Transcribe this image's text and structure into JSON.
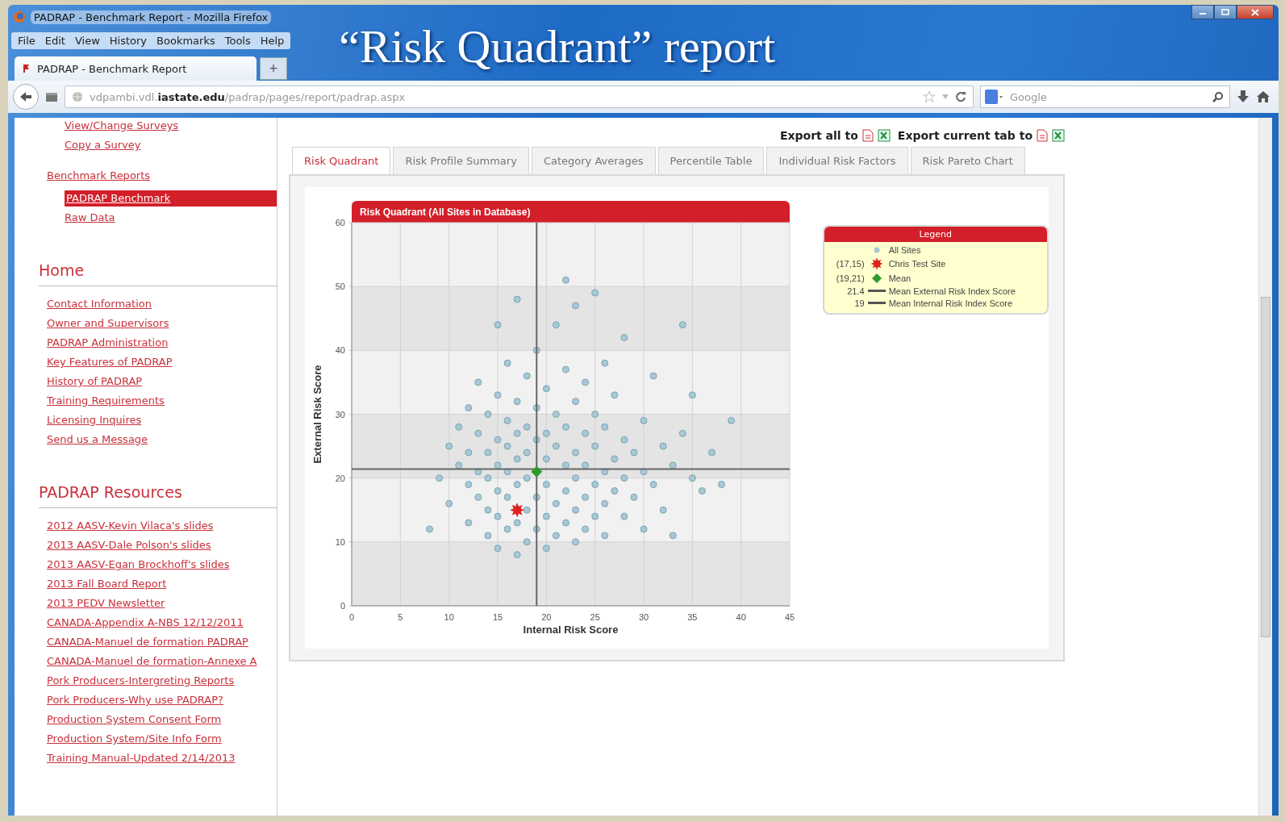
{
  "slide_title": "“Risk Quadrant” report",
  "window": {
    "title": "PADRAP - Benchmark Report - Mozilla Firefox"
  },
  "menu": [
    "File",
    "Edit",
    "View",
    "History",
    "Bookmarks",
    "Tools",
    "Help"
  ],
  "browser_tabs": [
    {
      "label": "PADRAP - Benchmark Report",
      "selected": true
    }
  ],
  "new_tab": "+",
  "address_bar": {
    "value": "vdpambi.vdl.**iastate.edu**/padrap/pages/report/padrap.aspx"
  },
  "search": {
    "placeholder": "Google"
  },
  "sidebar": {
    "sections": [
      {
        "links": [
          {
            "children": [
              {
                "label": "View/Change Surveys",
                "selected": false
              },
              {
                "label": "Copy a Survey",
                "selected": false
              }
            ]
          },
          {
            "label": "Benchmark Reports",
            "selected": false,
            "children": [
              {
                "label": "PADRAP Benchmark",
                "selected": true
              },
              {
                "label": "Raw Data",
                "selected": false
              }
            ]
          }
        ]
      },
      {
        "heading": "Home",
        "links": [
          {
            "label": "Contact Information",
            "selected": false
          },
          {
            "label": "Owner and Supervisors",
            "selected": false
          },
          {
            "label": "PADRAP Administration",
            "selected": false
          },
          {
            "label": "Key Features of PADRAP",
            "selected": false
          },
          {
            "label": "History of PADRAP",
            "selected": false
          },
          {
            "label": "Training Requirements",
            "selected": false
          },
          {
            "label": "Licensing Inquires",
            "selected": false
          },
          {
            "label": "Send us a Message",
            "selected": false
          }
        ]
      },
      {
        "heading": "PADRAP Resources",
        "links": [
          {
            "label": "2012 AASV-Kevin Vilaca's slides",
            "selected": false
          },
          {
            "label": "2013 AASV-Dale Polson's slides",
            "selected": false
          },
          {
            "label": "2013 AASV-Egan Brockhoff's slides",
            "selected": false
          },
          {
            "label": "2013 Fall Board Report",
            "selected": false
          },
          {
            "label": "2013 PEDV Newsletter",
            "selected": false
          },
          {
            "label": "CANADA-Appendix A-NBS 12/12/2011",
            "selected": false
          },
          {
            "label": "CANADA-Manuel de formation PADRAP",
            "selected": false
          },
          {
            "label": "CANADA-Manuel de formation-Annexe A",
            "selected": false
          },
          {
            "label": "Pork Producers-Intergreting Reports",
            "selected": false
          },
          {
            "label": "Pork Producers-Why use PADRAP?",
            "selected": false
          },
          {
            "label": "Production System Consent Form",
            "selected": false
          },
          {
            "label": "Production System/Site Info Form",
            "selected": false
          },
          {
            "label": "Training Manual-Updated 2/14/2013",
            "selected": false
          }
        ]
      }
    ]
  },
  "main": {
    "export": [
      {
        "label": "Export all to"
      },
      {
        "label": "Export current tab to"
      }
    ],
    "tabs": [
      {
        "label": "Risk Quadrant",
        "selected": true
      },
      {
        "label": "Risk Profile Summary",
        "selected": false
      },
      {
        "label": "Category Averages",
        "selected": false
      },
      {
        "label": "Percentile Table",
        "selected": false
      },
      {
        "label": "Individual Risk Factors",
        "selected": false
      },
      {
        "label": "Risk Pareto Chart",
        "selected": false
      }
    ],
    "chart": {
      "chart_data": {
        "type": "scatter",
        "title": "Risk Quadrant (All Sites in Database)",
        "xlabel": "Internal Risk Score",
        "ylabel": "External Risk Score",
        "xlim": [
          0,
          45
        ],
        "ylim": [
          0,
          60
        ],
        "xticks": [
          0,
          5,
          10,
          15,
          20,
          25,
          30,
          35,
          40,
          45
        ],
        "yticks": [
          0,
          10,
          20,
          30,
          40,
          50,
          60
        ],
        "grid": true,
        "series": [
          {
            "name": "All Sites",
            "marker": "circle",
            "color": "#a9c8d4",
            "x": [
              8,
              9,
              10,
              10,
              11,
              11,
              12,
              12,
              12,
              12,
              13,
              13,
              13,
              13,
              14,
              14,
              14,
              14,
              14,
              15,
              15,
              15,
              15,
              15,
              15,
              15,
              16,
              16,
              16,
              16,
              16,
              16,
              17,
              17,
              17,
              17,
              17,
              17,
              17,
              18,
              18,
              18,
              18,
              18,
              18,
              19,
              19,
              19,
              19,
              19,
              20,
              20,
              20,
              20,
              20,
              20,
              21,
              21,
              21,
              21,
              21,
              22,
              22,
              22,
              22,
              22,
              22,
              23,
              23,
              23,
              23,
              23,
              23,
              24,
              24,
              24,
              24,
              24,
              25,
              25,
              25,
              25,
              25,
              26,
              26,
              26,
              26,
              26,
              27,
              27,
              27,
              28,
              28,
              28,
              28,
              29,
              29,
              30,
              30,
              30,
              31,
              31,
              32,
              32,
              33,
              33,
              34,
              34,
              35,
              35,
              36,
              37,
              38,
              39
            ],
            "values": [
              12,
              20,
              25,
              16,
              22,
              28,
              13,
              19,
              24,
              31,
              17,
              21,
              27,
              35,
              11,
              15,
              20,
              24,
              30,
              9,
              14,
              18,
              22,
              26,
              33,
              44,
              12,
              17,
              21,
              25,
              29,
              38,
              8,
              13,
              19,
              23,
              27,
              32,
              48,
              10,
              15,
              20,
              24,
              28,
              36,
              12,
              17,
              26,
              31,
              40,
              9,
              14,
              19,
              23,
              27,
              34,
              11,
              16,
              25,
              30,
              44,
              13,
              18,
              22,
              28,
              37,
              51,
              10,
              15,
              20,
              24,
              32,
              47,
              12,
              17,
              22,
              27,
              35,
              14,
              19,
              25,
              30,
              49,
              11,
              16,
              21,
              28,
              38,
              18,
              23,
              33,
              14,
              20,
              26,
              42,
              17,
              24,
              12,
              21,
              29,
              19,
              36,
              15,
              25,
              11,
              22,
              27,
              44,
              20,
              33,
              18,
              24,
              19,
              29
            ]
          },
          {
            "name": "Chris Test Site",
            "marker": "star",
            "color": "#e02020",
            "x": [
              17
            ],
            "values": [
              15
            ]
          },
          {
            "name": "Mean",
            "marker": "diamond",
            "color": "#2e9a2e",
            "x": [
              19
            ],
            "values": [
              21
            ]
          }
        ],
        "ref_lines": [
          {
            "axis": "y",
            "value": 21.4
          },
          {
            "axis": "x",
            "value": 19
          }
        ]
      }
    },
    "legend": {
      "title": "Legend",
      "items": [
        {
          "kind": "dot",
          "color": "#a9c8d4"
        },
        {
          "kind": "star",
          "color": "#e02020",
          "value": "(17,15)"
        },
        {
          "kind": "diamond",
          "color": "#2e9a2e",
          "value": "(19,21)"
        },
        {
          "kind": "line",
          "color": "#555555",
          "value": "21.4",
          "label": "Mean External Risk Index Score"
        },
        {
          "kind": "line",
          "color": "#555555",
          "value": "19",
          "label": "Mean Internal Risk Index Score"
        }
      ]
    }
  }
}
